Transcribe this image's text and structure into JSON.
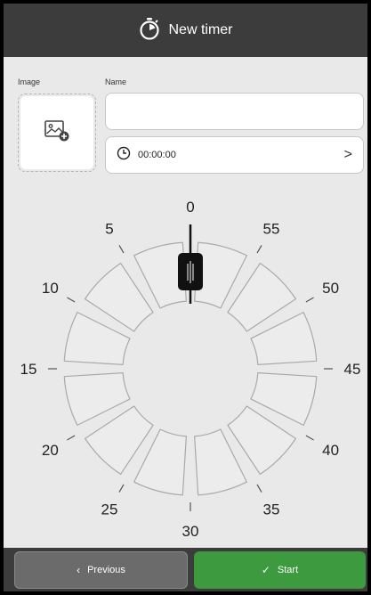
{
  "header": {
    "title": "New timer",
    "icon": "stopwatch-icon"
  },
  "form": {
    "image_label": "Image",
    "name_label": "Name",
    "name_value": "",
    "duration_value": "00:00:00",
    "image_icon": "add-image-icon",
    "clock_icon": "clock-icon",
    "chevron": ">"
  },
  "dial": {
    "ticks": [
      "0",
      "5",
      "10",
      "15",
      "20",
      "25",
      "30",
      "35",
      "40",
      "45",
      "50",
      "55"
    ],
    "selected_minute": 0
  },
  "footer": {
    "previous_label": "Previous",
    "previous_icon": "‹",
    "start_label": "Start",
    "start_icon": "✓"
  },
  "colors": {
    "header": "#3c3c3c",
    "start": "#3e9a3e",
    "previous": "#6b6b6b",
    "background": "#e9e9e9"
  }
}
